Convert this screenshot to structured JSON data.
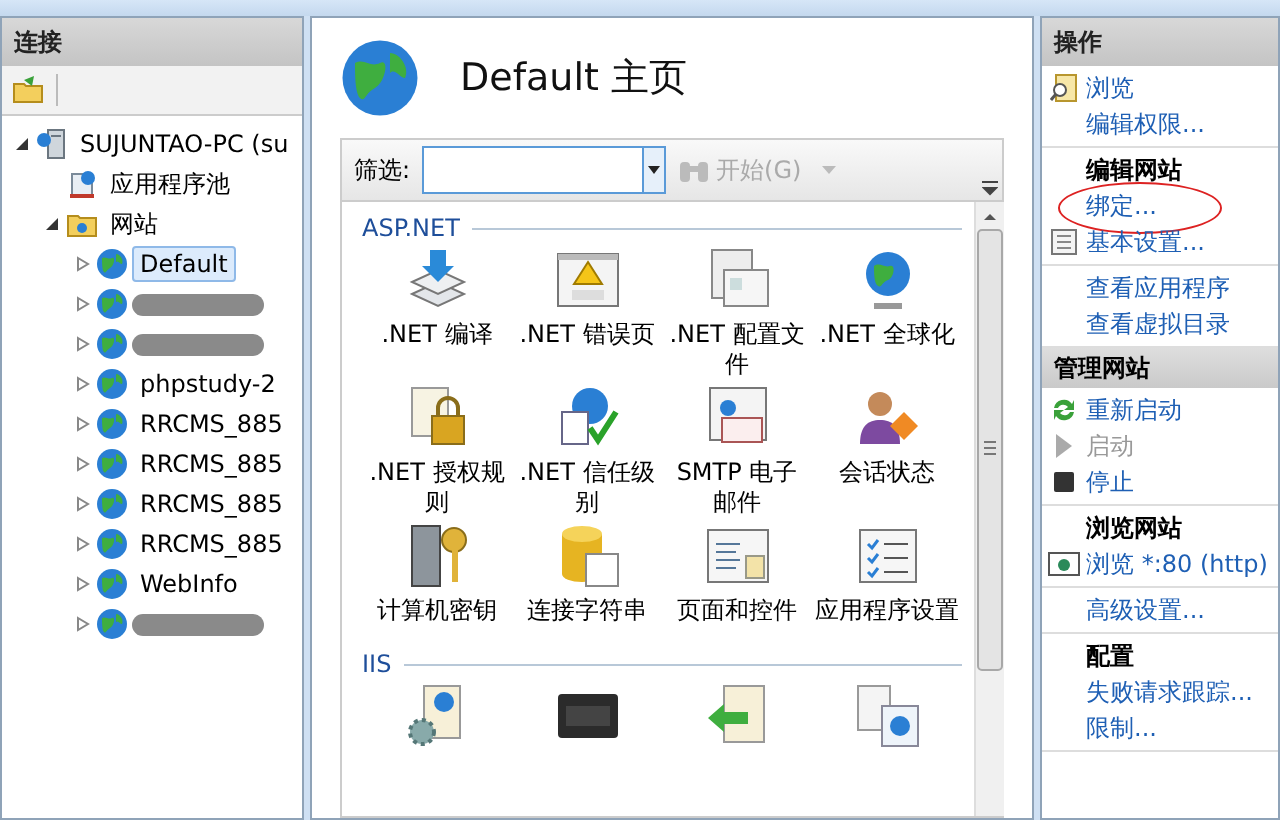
{
  "connections": {
    "title": "连接",
    "tree": [
      {
        "label": "SUJUNTAO-PC (su",
        "kind": "server",
        "expanded": true,
        "children": [
          {
            "label": "应用程序池",
            "kind": "pool"
          },
          {
            "label": "网站",
            "kind": "folder",
            "expanded": true,
            "children": [
              {
                "label": "Default",
                "kind": "site",
                "selected": true,
                "expanded": false
              },
              {
                "kind": "redacted",
                "selected": false,
                "expanded": false
              },
              {
                "kind": "redacted",
                "selected": false,
                "expanded": false
              },
              {
                "label": "phpstudy-2",
                "kind": "site",
                "selected": false,
                "expanded": false
              },
              {
                "label": "RRCMS_885",
                "kind": "site",
                "selected": false,
                "expanded": false
              },
              {
                "label": "RRCMS_885",
                "kind": "site",
                "selected": false,
                "expanded": false
              },
              {
                "label": "RRCMS_885",
                "kind": "site",
                "selected": false,
                "expanded": false
              },
              {
                "label": "RRCMS_885",
                "kind": "site",
                "selected": false,
                "expanded": false
              },
              {
                "label": "WebInfo",
                "kind": "site",
                "selected": false,
                "expanded": false
              },
              {
                "kind": "redacted",
                "selected": false,
                "expanded": false
              }
            ]
          }
        ]
      }
    ]
  },
  "main": {
    "title": "Default 主页",
    "filter": {
      "label": "筛选:",
      "go": "开始(G)"
    },
    "groups": [
      {
        "title": "ASP.NET",
        "features": [
          {
            "label": ".NET 编译",
            "kind": "download"
          },
          {
            "label": ".NET 错误页",
            "kind": "warning"
          },
          {
            "label": ".NET 配置文件",
            "kind": "window"
          },
          {
            "label": ".NET 全球化",
            "kind": "globe"
          },
          {
            "label": ".NET 授权规则",
            "kind": "lock"
          },
          {
            "label": ".NET 信任级别",
            "kind": "check"
          },
          {
            "label": "SMTP 电子邮件",
            "kind": "mail"
          },
          {
            "label": "会话状态",
            "kind": "person"
          },
          {
            "label": "计算机密钥",
            "kind": "key"
          },
          {
            "label": "连接字符串",
            "kind": "database"
          },
          {
            "label": "页面和控件",
            "kind": "form"
          },
          {
            "label": "应用程序设置",
            "kind": "list"
          }
        ]
      },
      {
        "title": "IIS",
        "features": [
          {
            "kind": "gear"
          },
          {
            "kind": "cgi"
          },
          {
            "kind": "arrow"
          },
          {
            "kind": "redirect"
          }
        ]
      }
    ]
  },
  "actions": {
    "title": "操作",
    "sections": [
      {
        "items": [
          {
            "label": "浏览",
            "kind": "browse",
            "disabled": false
          },
          {
            "label": "编辑权限...",
            "kind": "plain",
            "disabled": false
          }
        ]
      },
      {
        "heading": "编辑网站",
        "items": [
          {
            "label": "绑定...",
            "kind": "plain",
            "disabled": false,
            "circled": true
          },
          {
            "label": "基本设置...",
            "kind": "settings",
            "disabled": false,
            "circled": false
          }
        ]
      },
      {
        "items": [
          {
            "label": "查看应用程序",
            "kind": "plain",
            "disabled": false
          },
          {
            "label": "查看虚拟目录",
            "kind": "plain",
            "disabled": false
          }
        ]
      },
      {
        "heading": "管理网站",
        "kind": "panel",
        "items": [
          {
            "label": "重新启动",
            "kind": "restart",
            "disabled": false
          },
          {
            "label": "启动",
            "kind": "play",
            "disabled": true
          },
          {
            "label": "停止",
            "kind": "stop",
            "disabled": false
          }
        ]
      },
      {
        "heading": "浏览网站",
        "items": [
          {
            "label": "浏览 *:80 (http)",
            "kind": "web",
            "disabled": false
          }
        ]
      },
      {
        "items": [
          {
            "label": "高级设置...",
            "kind": "plain",
            "disabled": false
          }
        ]
      },
      {
        "heading": "配置",
        "items": [
          {
            "label": "失败请求跟踪...",
            "kind": "plain",
            "disabled": false
          },
          {
            "label": "限制...",
            "kind": "plain",
            "disabled": false
          }
        ]
      }
    ]
  }
}
